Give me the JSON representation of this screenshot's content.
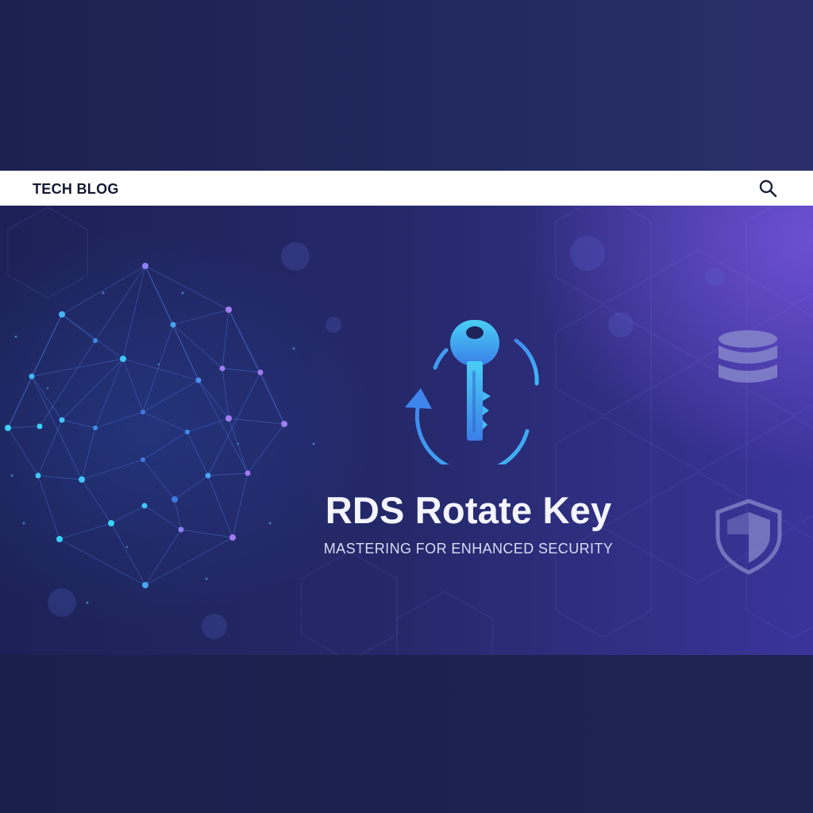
{
  "header": {
    "blog_title": "TECH BLOG",
    "search_icon": "search-icon"
  },
  "hero": {
    "title": "RDS Rotate Key",
    "subtitle": "MASTERING FOR ENHANCED SECURITY",
    "key_icon": "key-rotate-icon",
    "side_icons": [
      "database-icon",
      "shield-icon"
    ]
  },
  "colors": {
    "background": "#1d2250",
    "header_bg": "#ffffff",
    "header_text": "#151a33",
    "accent_cyan": "#39c6f4",
    "accent_blue": "#3e7ee8",
    "accent_purple": "#7a5ce0",
    "title_text": "#f3f4ff",
    "icon_muted": "#8c8fcf"
  }
}
